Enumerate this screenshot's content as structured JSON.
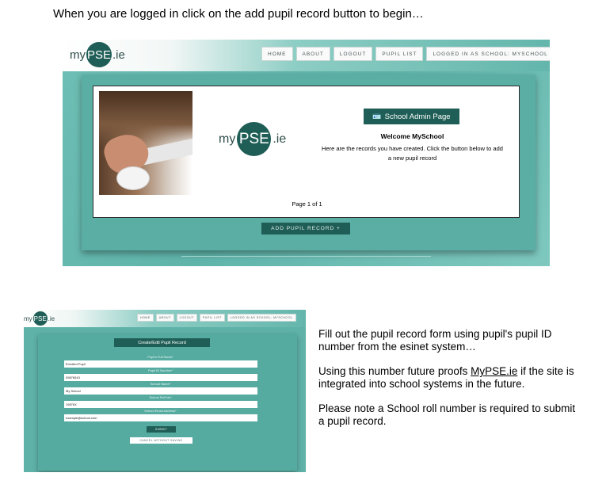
{
  "intro": "When you are logged in click on the add pupil record button to begin…",
  "brand": {
    "prefix": "my",
    "name": "PSE",
    "suffix": ".ie",
    "accent": "#1f5e56"
  },
  "nav": [
    "HOME",
    "ABOUT",
    "LOGOUT",
    "PUPIL LIST",
    "LOGGED IN AS SCHOOL: MYSCHOOL"
  ],
  "admin_page": {
    "button_label": "School Admin Page",
    "button_icon": "id-card-icon",
    "welcome": "Welcome MySchool",
    "records_text": "Here are the records you have created. Click the button below to add a new pupil record",
    "page_info": "Page 1 of 1",
    "add_button": "ADD PUPIL RECORD +"
  },
  "form": {
    "title": "Create/Edit Pupil Record",
    "fields": [
      {
        "label": "Pupil's Full Name*",
        "value": "Enrolled Pupil"
      },
      {
        "label": "Pupil ID Number*",
        "value": "09876543"
      },
      {
        "label": "School Name*",
        "value": "My School"
      },
      {
        "label": "School Roll No*",
        "value": "19876X"
      },
      {
        "label": "School Email Address*",
        "value": "example@school.com"
      }
    ],
    "submit": "SUBMIT",
    "cancel": "CANCEL WITHOUT SAVING"
  },
  "side": {
    "p1": "Fill out the pupil record form using pupil's pupil ID number from the esinet system…",
    "p2_before": "Using this number future proofs ",
    "p2_link": "MyPSE.ie",
    "p2_after": " if the site is integrated into school systems in the future.",
    "p3": "Please note a School roll number is required to submit a pupil record."
  }
}
